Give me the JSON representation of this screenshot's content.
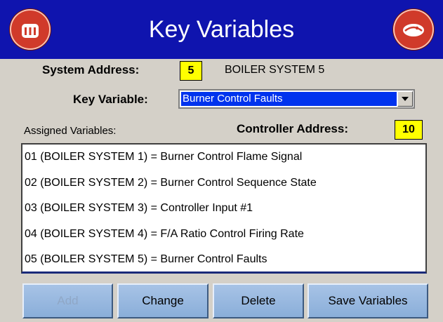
{
  "header": {
    "title": "Key Variables",
    "left_icon": "boiler-home-icon",
    "right_icon": "burner-icon"
  },
  "system": {
    "address_label": "System Address:",
    "address_value": "5",
    "name": "BOILER SYSTEM 5"
  },
  "key_variable": {
    "label": "Key Variable:",
    "selected": "Burner Control Faults"
  },
  "assigned": {
    "label": "Assigned Variables:"
  },
  "controller": {
    "address_label": "Controller Address:",
    "address_value": "10"
  },
  "variables": [
    "01 (BOILER SYSTEM 1) = Burner Control Flame Signal",
    "02 (BOILER SYSTEM 2) = Burner Control Sequence State",
    "03 (BOILER SYSTEM 3) = Controller Input #1",
    "04 (BOILER SYSTEM 4) = F/A Ratio Control Firing Rate",
    "05 (BOILER SYSTEM 5) = Burner Control Faults"
  ],
  "buttons": {
    "add": "Add",
    "change": "Change",
    "delete": "Delete",
    "save": "Save Variables"
  },
  "colors": {
    "header_bg": "#0f14ae",
    "accent_red": "#d03a2a",
    "highlight_yellow": "#ffff00",
    "selection_blue": "#0033ee",
    "button_blue": "#9bbbe0"
  }
}
